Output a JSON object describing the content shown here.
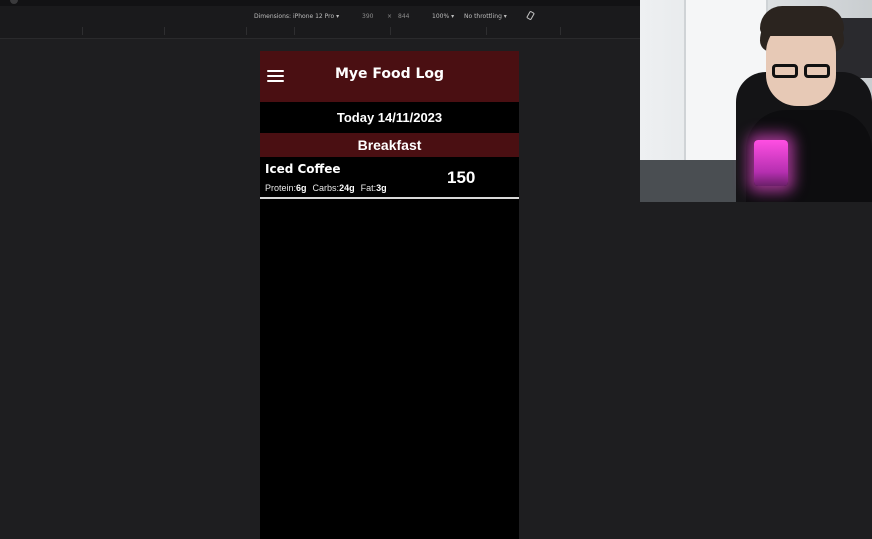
{
  "devtools": {
    "dimensions_label": "Dimensions: iPhone 12 Pro",
    "width": "390",
    "times": "×",
    "height": "844",
    "zoom": "100%",
    "throttling": "No throttling"
  },
  "app": {
    "title": "Mye Food Log",
    "date": "Today 14/11/2023",
    "meal": "Breakfast",
    "items": [
      {
        "name": "Iced Coffee",
        "protein_label": "Protein:",
        "protein": "6g",
        "carbs_label": "Carbs:",
        "carbs": "24g",
        "fat_label": "Fat:",
        "fat": "3g",
        "calories": "150"
      }
    ]
  },
  "icons": {
    "menu": "hamburger-menu-icon",
    "rotate": "rotate-device-icon"
  },
  "colors": {
    "header_bg": "#4a0f12",
    "screen_bg": "#000000",
    "divider": "#d8d8d8"
  }
}
